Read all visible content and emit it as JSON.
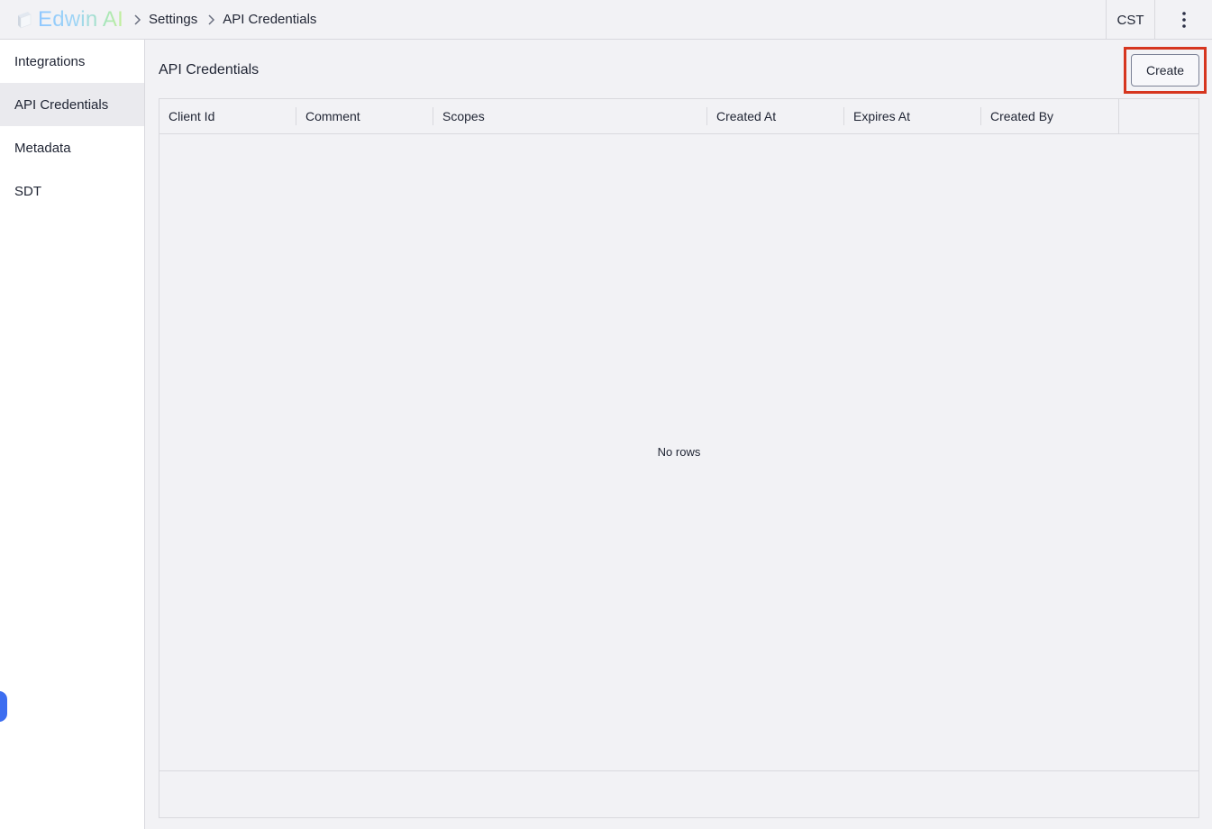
{
  "header": {
    "app_name": "Edwin AI",
    "breadcrumb": [
      "Settings",
      "API Credentials"
    ],
    "timezone": "CST",
    "menu_icon": "kebab-menu-icon",
    "logo_icon": "edwin-ai-logo-icon"
  },
  "sidebar": {
    "items": [
      {
        "label": "Integrations",
        "active": false
      },
      {
        "label": "API Credentials",
        "active": true
      },
      {
        "label": "Metadata",
        "active": false
      },
      {
        "label": "SDT",
        "active": false
      }
    ]
  },
  "main": {
    "title": "API Credentials",
    "create_label": "Create",
    "table": {
      "columns": [
        "Client Id",
        "Comment",
        "Scopes",
        "Created At",
        "Expires At",
        "Created By"
      ],
      "rows": [],
      "empty_text": "No rows"
    }
  },
  "colors": {
    "accent_highlight": "#d6361f",
    "help_button": "#3d6ef0"
  }
}
